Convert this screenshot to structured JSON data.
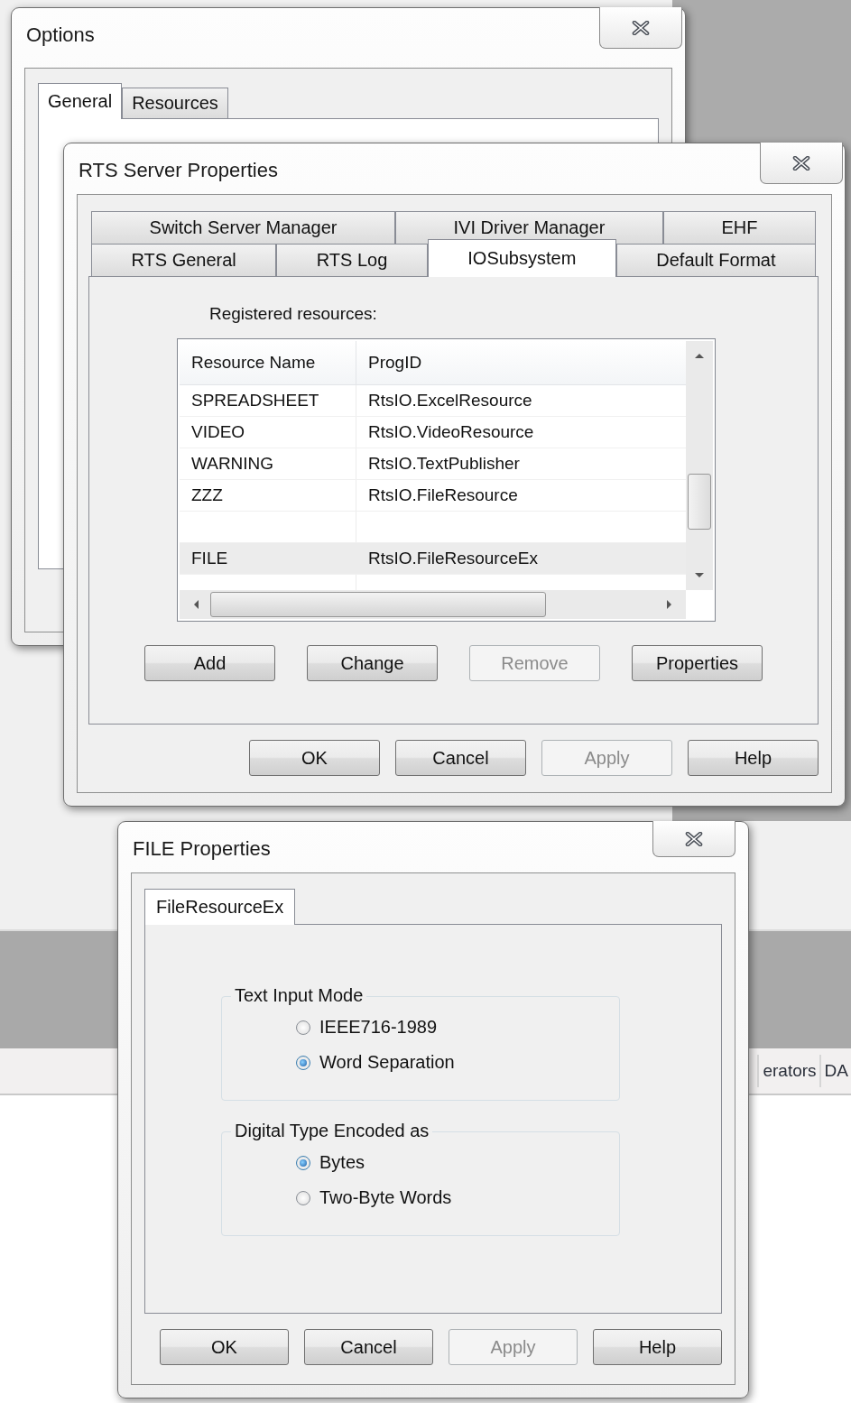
{
  "background_app": {
    "tabs": [
      {
        "label": "erators"
      },
      {
        "label": "DA"
      }
    ]
  },
  "options_window": {
    "title": "Options",
    "tabs": [
      {
        "label": "General",
        "selected": true
      },
      {
        "label": "Resources",
        "selected": false
      }
    ]
  },
  "rts_window": {
    "title": "RTS Server Properties",
    "tab_rows": [
      [
        {
          "label": "Switch Server Manager",
          "selected": false
        },
        {
          "label": "IVI Driver Manager",
          "selected": false
        },
        {
          "label": "EHF",
          "selected": false
        }
      ],
      [
        {
          "label": "RTS General",
          "selected": false
        },
        {
          "label": "RTS Log",
          "selected": false
        },
        {
          "label": "IOSubsystem",
          "selected": true
        },
        {
          "label": "Default Format",
          "selected": false
        }
      ]
    ],
    "section_label": "Registered resources:",
    "table": {
      "columns": [
        "Resource Name",
        "ProgID"
      ],
      "rows": [
        {
          "name": "SPREADSHEET",
          "prog_id": "RtsIO.ExcelResource",
          "selected": false
        },
        {
          "name": "VIDEO",
          "prog_id": "RtsIO.VideoResource",
          "selected": false
        },
        {
          "name": "WARNING",
          "prog_id": "RtsIO.TextPublisher",
          "selected": false
        },
        {
          "name": "ZZZ",
          "prog_id": "RtsIO.FileResource",
          "selected": false
        },
        {
          "selected": false
        },
        {
          "name": "FILE",
          "prog_id": "RtsIO.FileResourceEx",
          "selected": true
        },
        {
          "selected": false
        }
      ]
    },
    "panel_buttons": [
      {
        "label": "Add",
        "disabled": false
      },
      {
        "label": "Change",
        "disabled": false
      },
      {
        "label": "Remove",
        "disabled": true
      },
      {
        "label": "Properties",
        "disabled": false
      }
    ],
    "buttons": [
      {
        "label": "OK",
        "disabled": false
      },
      {
        "label": "Cancel",
        "disabled": false
      },
      {
        "label": "Apply",
        "disabled": true
      },
      {
        "label": "Help",
        "disabled": false
      }
    ]
  },
  "file_window": {
    "title": "FILE Properties",
    "tabs": [
      {
        "label": "FileResourceEx",
        "selected": true
      }
    ],
    "groups": [
      {
        "title": "Text Input Mode",
        "options": [
          {
            "label": "IEEE716-1989",
            "selected": false
          },
          {
            "label": "Word Separation",
            "selected": true
          }
        ]
      },
      {
        "title": "Digital Type Encoded as",
        "options": [
          {
            "label": "Bytes",
            "selected": true
          },
          {
            "label": "Two-Byte Words",
            "selected": false
          }
        ]
      }
    ],
    "buttons": [
      {
        "label": "OK",
        "disabled": false
      },
      {
        "label": "Cancel",
        "disabled": false
      },
      {
        "label": "Apply",
        "disabled": true
      },
      {
        "label": "Help",
        "disabled": false
      }
    ]
  }
}
